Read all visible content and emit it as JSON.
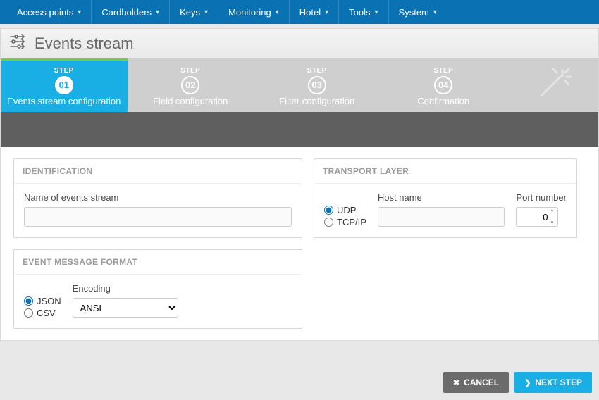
{
  "topnav": [
    {
      "label": "Access points"
    },
    {
      "label": "Cardholders"
    },
    {
      "label": "Keys"
    },
    {
      "label": "Monitoring"
    },
    {
      "label": "Hotel"
    },
    {
      "label": "Tools"
    },
    {
      "label": "System"
    }
  ],
  "page_title": "Events stream",
  "wizard": {
    "step_word": "STEP",
    "steps": [
      {
        "num": "01",
        "label": "Events stream configuration",
        "active": true
      },
      {
        "num": "02",
        "label": "Field configuration",
        "active": false
      },
      {
        "num": "03",
        "label": "Filter configuration",
        "active": false
      },
      {
        "num": "04",
        "label": "Confirmation",
        "active": false
      }
    ]
  },
  "panels": {
    "identification": {
      "title": "IDENTIFICATION",
      "name_label": "Name of events stream",
      "name_value": ""
    },
    "transport": {
      "title": "TRANSPORT LAYER",
      "radios": {
        "udp": "UDP",
        "tcp": "TCP/IP",
        "selected": "udp"
      },
      "host_label": "Host name",
      "host_value": "",
      "port_label": "Port number",
      "port_value": "0"
    },
    "format": {
      "title": "EVENT MESSAGE FORMAT",
      "radios": {
        "json": "JSON",
        "csv": "CSV",
        "selected": "json"
      },
      "encoding_label": "Encoding",
      "encoding_value": "ANSI"
    }
  },
  "buttons": {
    "cancel": "CANCEL",
    "next": "NEXT STEP"
  }
}
